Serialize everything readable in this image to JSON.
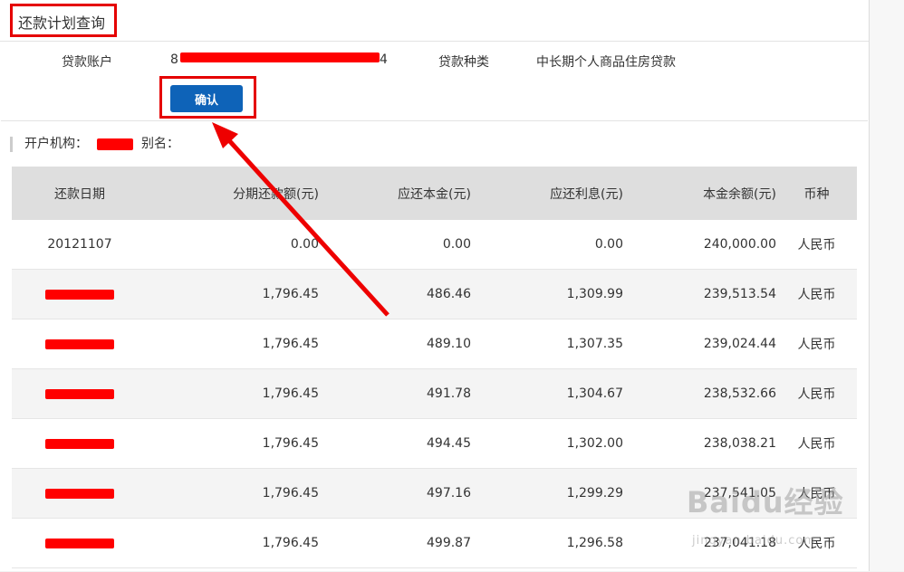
{
  "page_title": "还款计划查询",
  "loan_account": {
    "label": "贷款账户",
    "value_start": "8",
    "value_end": "4"
  },
  "loan_type": {
    "label": "贷款种类",
    "value": "中长期个人商品住房贷款"
  },
  "confirm_label": "确认",
  "info": {
    "org_label": "开户机构：",
    "alias_label": "别名："
  },
  "table": {
    "headers": [
      "还款日期",
      "分期还款额(元)",
      "应还本金(元)",
      "应还利息(元)",
      "本金余额(元)",
      "币种"
    ],
    "rows": [
      {
        "date": "20121107",
        "installment": "0.00",
        "principal": "0.00",
        "interest": "0.00",
        "balance": "240,000.00",
        "currency": "人民币"
      },
      {
        "date": "",
        "installment": "1,796.45",
        "principal": "486.46",
        "interest": "1,309.99",
        "balance": "239,513.54",
        "currency": "人民币"
      },
      {
        "date": "",
        "installment": "1,796.45",
        "principal": "489.10",
        "interest": "1,307.35",
        "balance": "239,024.44",
        "currency": "人民币"
      },
      {
        "date": "",
        "installment": "1,796.45",
        "principal": "491.78",
        "interest": "1,304.67",
        "balance": "238,532.66",
        "currency": "人民币"
      },
      {
        "date": "",
        "installment": "1,796.45",
        "principal": "494.45",
        "interest": "1,302.00",
        "balance": "238,038.21",
        "currency": "人民币"
      },
      {
        "date": "",
        "installment": "1,796.45",
        "principal": "497.16",
        "interest": "1,299.29",
        "balance": "237,541.05",
        "currency": "人民币"
      },
      {
        "date": "",
        "installment": "1,796.45",
        "principal": "499.87",
        "interest": "1,296.58",
        "balance": "237,041.18",
        "currency": "人民币"
      }
    ]
  },
  "watermark": {
    "main": "Baidu经验",
    "sub": "jingyan.baidu.com"
  },
  "colors": {
    "highlight": "#e50000",
    "button": "#0e63b8",
    "header_bg": "#dedede"
  }
}
